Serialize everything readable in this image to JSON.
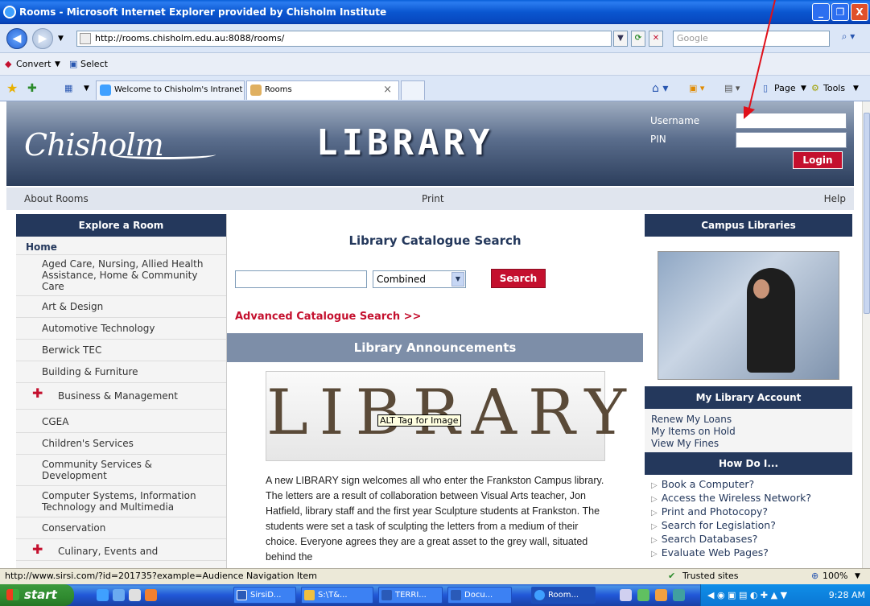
{
  "window": {
    "title": "Rooms - Microsoft Internet Explorer provided by Chisholm Institute",
    "min_label": "_",
    "max_label": "❐",
    "close_label": "X"
  },
  "addressbar": {
    "url": "http://rooms.chisholm.edu.au:8088/rooms/",
    "search_placeholder": "Google"
  },
  "toolbar": {
    "convert_label": "Convert",
    "select_label": "Select"
  },
  "tabs": [
    {
      "label": "Welcome to Chisholm's Intranet"
    },
    {
      "label": "Rooms",
      "close": "×"
    }
  ],
  "command_bar": {
    "page_label": "Page",
    "tools_label": "Tools"
  },
  "header": {
    "logo_text": "Chisholm",
    "title": "LIBRARY",
    "username_label": "Username",
    "pin_label": "PIN",
    "login_button": "Login"
  },
  "menubar": {
    "about": "About Rooms",
    "print": "Print",
    "help": "Help"
  },
  "explore": {
    "heading": "Explore a Room",
    "home": "Home",
    "rooms": [
      {
        "label": "Aged Care, Nursing, Allied Health Assistance, Home & Community Care",
        "plus": false
      },
      {
        "label": "Art & Design",
        "plus": false
      },
      {
        "label": "Automotive Technology",
        "plus": false
      },
      {
        "label": "Berwick TEC",
        "plus": false
      },
      {
        "label": "Building & Furniture",
        "plus": false
      },
      {
        "label": "Business & Management",
        "plus": true
      },
      {
        "label": "CGEA",
        "plus": false
      },
      {
        "label": "Children's Services",
        "plus": false
      },
      {
        "label": "Community Services & Development",
        "plus": false
      },
      {
        "label": "Computer Systems, Information Technology and Multimedia",
        "plus": false
      },
      {
        "label": "Conservation",
        "plus": false
      },
      {
        "label": "Culinary, Events and",
        "plus": true
      }
    ]
  },
  "catalogue": {
    "title": "Library Catalogue Search",
    "select_value": "Combined",
    "search_button": "Search",
    "advanced_link": "Advanced Catalogue Search >>"
  },
  "announcements": {
    "heading": "Library Announcements",
    "image_letters": "LIBRARY",
    "alt_tag": "ALT Tag for Image",
    "text": "A new LIBRARY sign welcomes all who enter the Frankston Campus library. The letters are a result of collaboration between Visual Arts teacher, Jon Hatfield, library staff and the first year Sculpture students at Frankston. The students were set a task of sculpting the letters from a medium of their choice. Everyone agrees they are a great asset to the grey wall, situated behind the"
  },
  "campus": {
    "heading": "Campus Libraries"
  },
  "account": {
    "heading": "My Library Account",
    "links": [
      "Renew My Loans",
      "My Items on Hold",
      "View My Fines"
    ]
  },
  "howdo": {
    "heading": "How Do I...",
    "items": [
      "Book a Computer?",
      "Access the Wireless Network?",
      "Print and Photocopy?",
      "Search for Legislation?",
      "Search Databases?",
      "Evaluate Web Pages?"
    ]
  },
  "status": {
    "url": "http://www.sirsi.com/?id=201735?example=Audience Navigation Item",
    "zone": "Trusted sites",
    "zoom": "100%"
  },
  "taskbar": {
    "start": "start",
    "items": [
      "SirsiD...",
      "S:\\T&...",
      "TERRI...",
      "Docu...",
      "Room..."
    ],
    "clock": "9:28 AM"
  }
}
